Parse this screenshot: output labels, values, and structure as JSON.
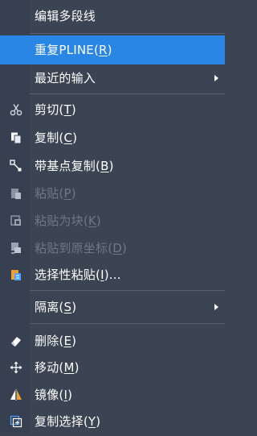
{
  "menu": {
    "items": {
      "edit_polyline": {
        "label": "编辑多段线"
      },
      "repeat_pline": {
        "label": "重复PLINE",
        "mnemonic": "R"
      },
      "recent_input": {
        "label": "最近的输入"
      },
      "cut": {
        "label": "剪切",
        "mnemonic": "T",
        "icon": "scissors-icon"
      },
      "copy": {
        "label": "复制",
        "mnemonic": "C",
        "icon": "copy-icon"
      },
      "copy_base": {
        "label": "带基点复制",
        "mnemonic": "B",
        "icon": "copy-with-base-point-icon"
      },
      "paste": {
        "label": "粘贴",
        "mnemonic": "P",
        "icon": "paste-icon"
      },
      "paste_block": {
        "label": "粘贴为块",
        "mnemonic": "K",
        "icon": "paste-as-block-icon"
      },
      "paste_orig": {
        "label": "粘贴到原坐标",
        "mnemonic": "D",
        "icon": "paste-original-coords-icon"
      },
      "paste_special": {
        "label": "选择性粘贴",
        "mnemonic": "I",
        "suffix": "...",
        "icon": "paste-special-icon"
      },
      "isolate": {
        "label": "隔离",
        "mnemonic": "S"
      },
      "erase": {
        "label": "删除",
        "mnemonic": "E",
        "icon": "eraser-icon"
      },
      "move": {
        "label": "移动",
        "mnemonic": "M",
        "icon": "move-icon"
      },
      "mirror": {
        "label": "镜像",
        "mnemonic": "I",
        "icon": "mirror-icon"
      },
      "copy_selection": {
        "label": "复制选择",
        "mnemonic": "Y",
        "icon": "copy-selection-icon"
      }
    }
  },
  "colors": {
    "background": "#3b4453",
    "highlight": "#2a86e4",
    "disabled_text": "#6f7888",
    "icon_blue": "#4da3ff",
    "icon_orange": "#f0a030"
  }
}
